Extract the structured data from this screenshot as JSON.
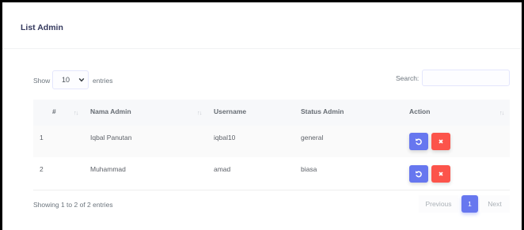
{
  "card": {
    "title": "List Admin"
  },
  "length_menu": {
    "show_label": "Show",
    "selected": "10",
    "entries_label": "entries"
  },
  "search": {
    "label": "Search:",
    "value": ""
  },
  "table": {
    "columns": [
      "#",
      "Nama Admin",
      "Username",
      "Status Admin",
      "Action"
    ],
    "rows": [
      {
        "no": "1",
        "nama": "Iqbal Panutan",
        "username": "iqbal10",
        "status": "general"
      },
      {
        "no": "2",
        "nama": "Muhammad",
        "username": "amad",
        "status": "biasa"
      }
    ],
    "actions": {
      "reset_icon": "undo-icon",
      "delete_icon": "close-icon"
    }
  },
  "footer": {
    "info": "Showing 1 to 2 of 2 entries"
  },
  "pagination": {
    "previous": "Previous",
    "current": "1",
    "next": "Next"
  },
  "colors": {
    "primary": "#6777ef",
    "danger": "#fc544b"
  }
}
